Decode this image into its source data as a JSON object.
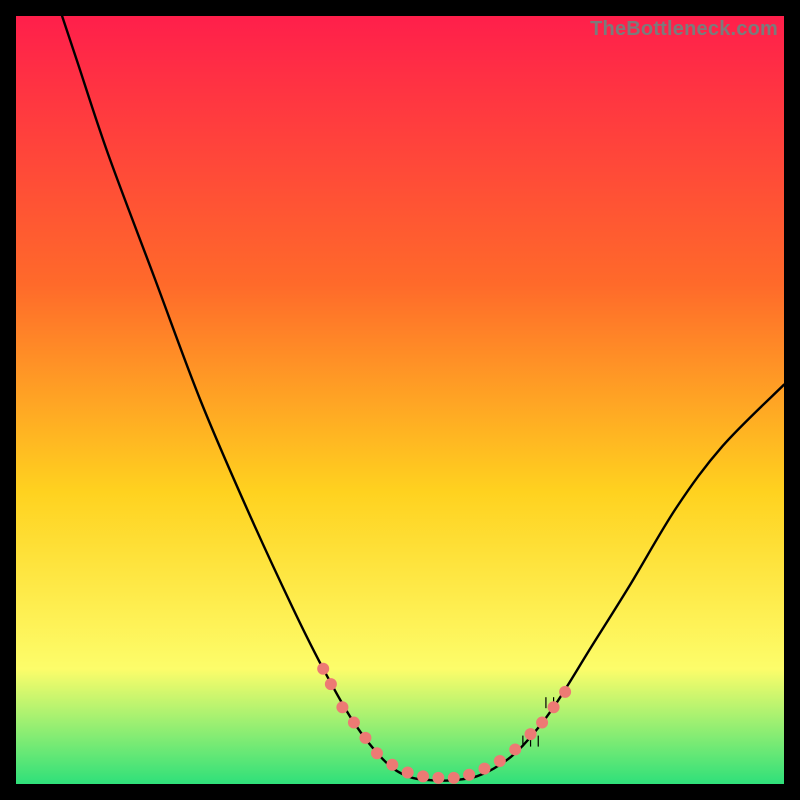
{
  "watermark": "TheBottleneck.com",
  "colors": {
    "bg": "#000000",
    "grad_top": "#ff1f4b",
    "grad_mid_upper": "#ff6a2a",
    "grad_mid": "#ffd21f",
    "grad_lower": "#fdfd6a",
    "grad_bottom": "#2fe07a",
    "curve": "#000000",
    "marker": "#ed7a74"
  },
  "chart_data": {
    "type": "line",
    "title": "",
    "xlabel": "",
    "ylabel": "",
    "xlim": [
      0,
      100
    ],
    "ylim": [
      0,
      100
    ],
    "curve": [
      {
        "x": 6,
        "y": 100
      },
      {
        "x": 8,
        "y": 94
      },
      {
        "x": 12,
        "y": 82
      },
      {
        "x": 18,
        "y": 66
      },
      {
        "x": 24,
        "y": 50
      },
      {
        "x": 30,
        "y": 36
      },
      {
        "x": 36,
        "y": 23
      },
      {
        "x": 40,
        "y": 15
      },
      {
        "x": 44,
        "y": 8
      },
      {
        "x": 48,
        "y": 3
      },
      {
        "x": 51,
        "y": 1
      },
      {
        "x": 54,
        "y": 0.5
      },
      {
        "x": 57,
        "y": 0.5
      },
      {
        "x": 60,
        "y": 1
      },
      {
        "x": 63,
        "y": 2.5
      },
      {
        "x": 66,
        "y": 5
      },
      {
        "x": 70,
        "y": 10
      },
      {
        "x": 75,
        "y": 18
      },
      {
        "x": 80,
        "y": 26
      },
      {
        "x": 86,
        "y": 36
      },
      {
        "x": 92,
        "y": 44
      },
      {
        "x": 100,
        "y": 52
      }
    ],
    "marker_points": [
      {
        "x": 40,
        "y": 15
      },
      {
        "x": 41,
        "y": 13
      },
      {
        "x": 42.5,
        "y": 10
      },
      {
        "x": 44,
        "y": 8
      },
      {
        "x": 45.5,
        "y": 6
      },
      {
        "x": 47,
        "y": 4
      },
      {
        "x": 49,
        "y": 2.5
      },
      {
        "x": 51,
        "y": 1.5
      },
      {
        "x": 53,
        "y": 1
      },
      {
        "x": 55,
        "y": 0.8
      },
      {
        "x": 57,
        "y": 0.8
      },
      {
        "x": 59,
        "y": 1.2
      },
      {
        "x": 61,
        "y": 2
      },
      {
        "x": 63,
        "y": 3
      },
      {
        "x": 65,
        "y": 4.5
      },
      {
        "x": 67,
        "y": 6.5
      },
      {
        "x": 68.5,
        "y": 8
      },
      {
        "x": 70,
        "y": 10
      },
      {
        "x": 71.5,
        "y": 12
      }
    ]
  }
}
